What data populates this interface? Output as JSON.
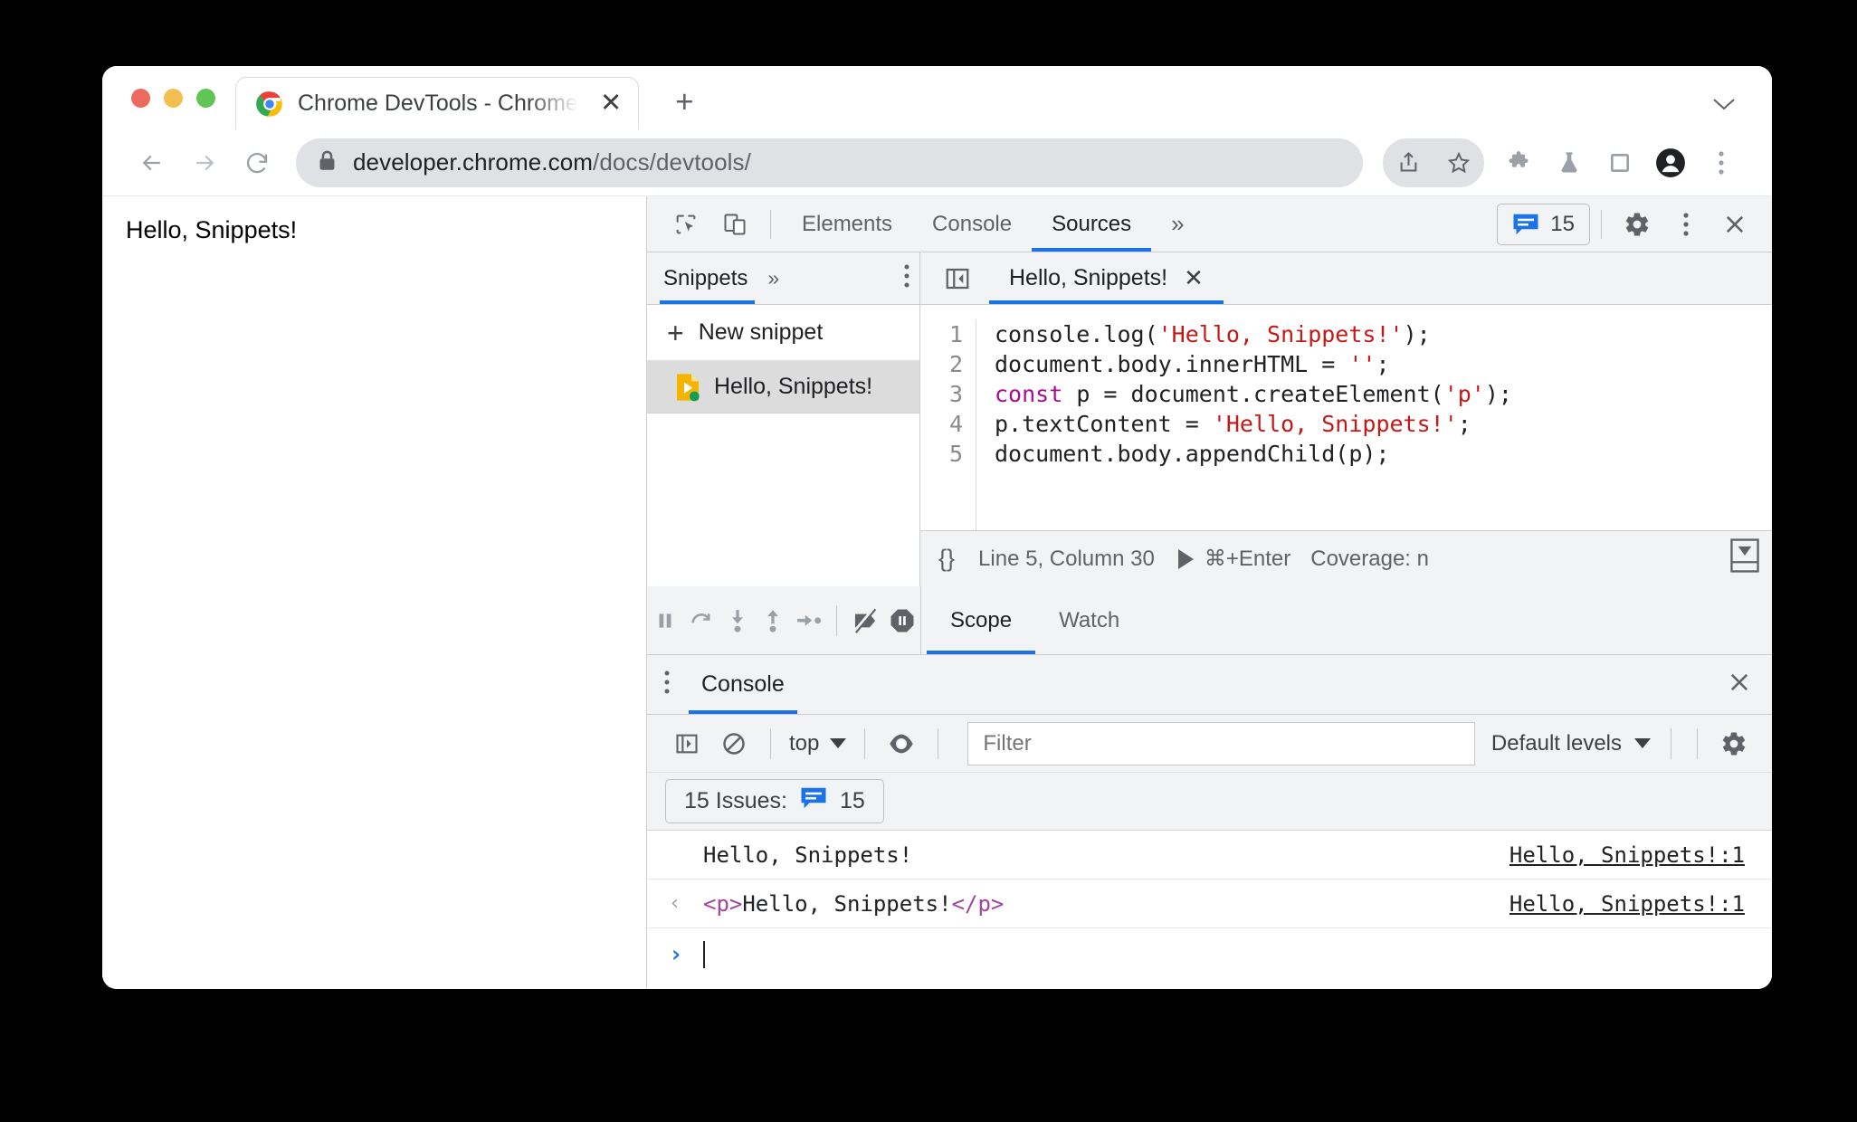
{
  "browser": {
    "tab": {
      "title": "Chrome DevTools - Chrome De",
      "close_label": "✕",
      "favicon": "chrome-logo-icon"
    },
    "new_tab_label": "+",
    "tabstrip_chevron": "⌄",
    "nav": {
      "back": "back-arrow-icon",
      "forward": "forward-arrow-icon",
      "reload": "reload-icon"
    },
    "omnibox": {
      "lock": "lock-icon",
      "host": "developer.chrome.com",
      "path": "/docs/devtools/"
    },
    "toolbar_icons": [
      "share-icon",
      "bookmark-star-icon",
      "extensions-puzzle-icon",
      "lab-flask-icon",
      "side-panel-icon",
      "profile-avatar-icon",
      "kebab-menu-icon"
    ]
  },
  "viewport": {
    "text": "Hello, Snippets!"
  },
  "devtools": {
    "toolbar": {
      "inspect_icon": "inspect-element-icon",
      "device_icon": "device-toolbar-icon",
      "tabs": [
        {
          "label": "Elements",
          "active": false
        },
        {
          "label": "Console",
          "active": false
        },
        {
          "label": "Sources",
          "active": true
        }
      ],
      "more_tabs": "»",
      "issues_count": "15",
      "settings_icon": "gear-icon",
      "kebab_icon": "kebab-menu-icon",
      "close_icon": "close-icon"
    },
    "snippets": {
      "tab_label": "Snippets",
      "more_label": "»",
      "kebab": "kebab-menu-icon",
      "new_snippet_label": "New snippet",
      "new_snippet_plus": "+",
      "items": [
        {
          "name": "Hello, Snippets!",
          "icon": "snippet-file-icon",
          "selected": true
        }
      ]
    },
    "editor": {
      "collapse_icon": "collapse-sidebar-icon",
      "tab_label": "Hello, Snippets!",
      "tab_close": "✕",
      "line_numbers": [
        "1",
        "2",
        "3",
        "4",
        "5"
      ],
      "code_lines": [
        {
          "parts": [
            {
              "t": "console.log(",
              "c": "plain"
            },
            {
              "t": "'Hello, Snippets!'",
              "c": "string"
            },
            {
              "t": ");",
              "c": "plain"
            }
          ]
        },
        {
          "parts": [
            {
              "t": "document.body.innerHTML = ",
              "c": "plain"
            },
            {
              "t": "''",
              "c": "string"
            },
            {
              "t": ";",
              "c": "plain"
            }
          ]
        },
        {
          "parts": [
            {
              "t": "const",
              "c": "keyword"
            },
            {
              "t": " p = document.createElement(",
              "c": "plain"
            },
            {
              "t": "'p'",
              "c": "string"
            },
            {
              "t": ");",
              "c": "plain"
            }
          ]
        },
        {
          "parts": [
            {
              "t": "p.textContent = ",
              "c": "plain"
            },
            {
              "t": "'Hello, Snippets!'",
              "c": "string"
            },
            {
              "t": ";",
              "c": "plain"
            }
          ]
        },
        {
          "parts": [
            {
              "t": "document.body.appendChild(p);",
              "c": "plain"
            }
          ]
        }
      ],
      "status": {
        "pretty_print": "{}",
        "position": "Line 5, Column 30",
        "run_shortcut": "⌘+Enter",
        "coverage": "Coverage: n",
        "more_icon": "show-more-icon"
      }
    },
    "debugger": {
      "buttons": [
        "pause-resume-icon",
        "step-over-icon",
        "step-into-icon",
        "step-out-icon",
        "step-icon",
        "deactivate-breakpoints-icon",
        "pause-on-exceptions-icon"
      ],
      "side_tabs": [
        {
          "label": "Scope",
          "active": true
        },
        {
          "label": "Watch",
          "active": false
        }
      ]
    },
    "drawer": {
      "kebab": "kebab-menu-icon",
      "tab_label": "Console",
      "close_icon": "close-icon",
      "toolbar": {
        "sidebar_icon": "console-sidebar-icon",
        "clear_icon": "clear-console-icon",
        "context": "top",
        "eye_icon": "live-expression-icon",
        "filter_placeholder": "Filter",
        "levels_label": "Default levels",
        "settings_icon": "gear-icon"
      },
      "issues_bar": {
        "label": "15 Issues:",
        "count": "15"
      },
      "messages": [
        {
          "arrow": "",
          "text": "Hello, Snippets!",
          "source": "Hello, Snippets!:1",
          "kind": "log"
        },
        {
          "arrow": "‹",
          "open_tag": "<p>",
          "text": "Hello, Snippets!",
          "close_tag": "</p>",
          "source": "Hello, Snippets!:1",
          "kind": "result"
        }
      ],
      "prompt": {
        "arrow": "›",
        "value": ""
      }
    }
  },
  "colors": {
    "accent": "#1a73e8",
    "chip_blue": "#1a73e8",
    "string": "#c41a16",
    "keyword": "#aa0d91",
    "tag": "#a0449c",
    "toolbar_bg": "#f1f3f4"
  }
}
